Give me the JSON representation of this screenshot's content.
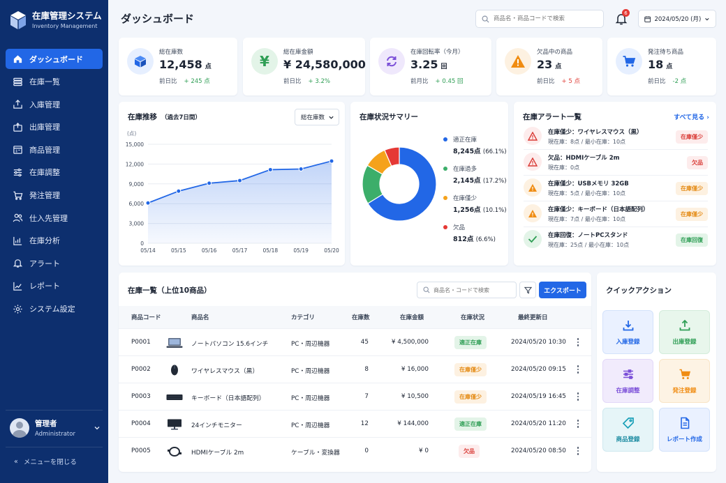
{
  "app": {
    "title": "在庫管理システム",
    "subtitle": "Inventory Management"
  },
  "sidebar": {
    "items": [
      {
        "label": "ダッシュボード",
        "icon": "home-icon",
        "active": true
      },
      {
        "label": "在庫一覧",
        "icon": "list-icon"
      },
      {
        "label": "入庫管理",
        "icon": "inbound-icon"
      },
      {
        "label": "出庫管理",
        "icon": "outbound-icon"
      },
      {
        "label": "商品管理",
        "icon": "product-icon"
      },
      {
        "label": "在庫調整",
        "icon": "sliders-icon"
      },
      {
        "label": "発注管理",
        "icon": "cart-icon"
      },
      {
        "label": "仕入先管理",
        "icon": "users-icon"
      },
      {
        "label": "在庫分析",
        "icon": "analytics-icon"
      },
      {
        "label": "アラート",
        "icon": "bell-icon"
      },
      {
        "label": "レポート",
        "icon": "report-icon"
      },
      {
        "label": "システム設定",
        "icon": "gear-icon"
      }
    ],
    "user": {
      "name": "管理者",
      "role": "Administrator"
    },
    "collapse_label": "メニューを閉じる"
  },
  "header": {
    "title": "ダッシュボード",
    "search_placeholder": "商品名・商品コードで検索",
    "notification_count": "6",
    "date_label": "2024/05/20 (月)"
  },
  "stats": [
    {
      "label": "総在庫数",
      "value": "12,458",
      "unit": "点",
      "compare_label": "前日比",
      "delta": "+ 245 点",
      "trend": "up",
      "icon": "cube-icon",
      "color": "#2267e6",
      "bg": "#e6efff"
    },
    {
      "label": "総在庫金額",
      "value": "¥ 24,580,000",
      "unit": "",
      "compare_label": "前日比",
      "delta": "+ 3.2%",
      "trend": "up",
      "icon": "yen-icon",
      "color": "#2f9e55",
      "bg": "#e3f4e8"
    },
    {
      "label": "在庫回転率（今月）",
      "value": "3.25",
      "unit": "回",
      "compare_label": "前月比",
      "delta": "+ 0.45 回",
      "trend": "up",
      "icon": "refresh-icon",
      "color": "#7b4fd8",
      "bg": "#efe8fc"
    },
    {
      "label": "欠品中の商品",
      "value": "23",
      "unit": "点",
      "compare_label": "前日比",
      "delta": "+ 5 点",
      "trend": "down",
      "icon": "warning-icon",
      "color": "#f08c12",
      "bg": "#fdf1e1"
    },
    {
      "label": "発注待ち商品",
      "value": "18",
      "unit": "点",
      "compare_label": "前日比",
      "delta": "-2 点",
      "trend": "up",
      "icon": "cart-icon",
      "color": "#2267e6",
      "bg": "#e6efff"
    }
  ],
  "trend_card": {
    "title": "在庫推移",
    "subtitle": "（過去7日間）",
    "select_label": "総在庫数"
  },
  "chart_data": [
    {
      "type": "area",
      "title": "在庫推移",
      "ylabel": "(点)",
      "categories": [
        "05/14",
        "05/15",
        "05/16",
        "05/17",
        "05/18",
        "05/19",
        "05/20"
      ],
      "values": [
        6100,
        7900,
        9100,
        9500,
        11150,
        11250,
        12458
      ],
      "yticks": [
        "0",
        "3,000",
        "6,000",
        "9,000",
        "12,000",
        "15,000"
      ],
      "ylim": [
        0,
        15000
      ],
      "grid": true,
      "color": "#2267e6"
    },
    {
      "type": "pie",
      "title": "在庫状況サマリー",
      "series": [
        {
          "name": "適正在庫",
          "value": 8245,
          "value_label": "8,245点",
          "pct": "(66.1%)",
          "color": "#2267e6"
        },
        {
          "name": "在庫過多",
          "value": 2145,
          "value_label": "2,145点",
          "pct": "(17.2%)",
          "color": "#3cae6a"
        },
        {
          "name": "在庫僅少",
          "value": 1256,
          "value_label": "1,256点",
          "pct": "(10.1%)",
          "color": "#f5a21b"
        },
        {
          "name": "欠品",
          "value": 812,
          "value_label": "812点",
          "pct": "(6.6%)",
          "color": "#e53935"
        }
      ]
    }
  ],
  "alerts": {
    "title": "在庫アラート一覧",
    "link_label": "すべて見る",
    "items": [
      {
        "title": "在庫僅少：ワイヤレスマウス（黒）",
        "sub": "現在庫：8点 / 最小在庫：10点",
        "badge": "在庫僅少",
        "kind": "low"
      },
      {
        "title": "欠品：HDMIケーブル 2m",
        "sub": "現在庫：0点",
        "badge": "欠品",
        "kind": "out"
      },
      {
        "title": "在庫僅少：USBメモリ 32GB",
        "sub": "現在庫：5点 / 最小在庫：10点",
        "badge": "在庫僅少",
        "kind": "warn"
      },
      {
        "title": "在庫僅少：キーボード（日本語配列）",
        "sub": "現在庫：7点 / 最小在庫：10点",
        "badge": "在庫僅少",
        "kind": "warn"
      },
      {
        "title": "在庫回復：ノートPCスタンド",
        "sub": "現在庫：25点 / 最小在庫：10点",
        "badge": "在庫回復",
        "kind": "ok"
      }
    ]
  },
  "inventory_table": {
    "title": "在庫一覧（上位10商品）",
    "search_placeholder": "商品名・コードで検索",
    "export_label": "エクスポート",
    "columns": [
      "商品コード",
      "商品名",
      "カテゴリ",
      "在庫数",
      "在庫金額",
      "在庫状況",
      "最終更新日"
    ],
    "rows": [
      {
        "code": "P0001",
        "name": "ノートパソコン 15.6インチ",
        "category": "PC・周辺機器",
        "qty": "45",
        "amount": "¥ 4,500,000",
        "status": "適正在庫",
        "kind": "ok",
        "updated": "2024/05/20 10:30",
        "thumb": "laptop"
      },
      {
        "code": "P0002",
        "name": "ワイヤレスマウス（黒）",
        "category": "PC・周辺機器",
        "qty": "8",
        "amount": "¥ 16,000",
        "status": "在庫僅少",
        "kind": "warn",
        "updated": "2024/05/20 09:15",
        "thumb": "mouse"
      },
      {
        "code": "P0003",
        "name": "キーボード（日本語配列）",
        "category": "PC・周辺機器",
        "qty": "7",
        "amount": "¥ 10,500",
        "status": "在庫僅少",
        "kind": "warn",
        "updated": "2024/05/19 16:45",
        "thumb": "keyboard"
      },
      {
        "code": "P0004",
        "name": "24インチモニター",
        "category": "PC・周辺機器",
        "qty": "12",
        "amount": "¥ 144,000",
        "status": "適正在庫",
        "kind": "ok",
        "updated": "2024/05/20 11:20",
        "thumb": "monitor"
      },
      {
        "code": "P0005",
        "name": "HDMIケーブル 2m",
        "category": "ケーブル・変換器",
        "qty": "0",
        "amount": "¥ 0",
        "status": "欠品",
        "kind": "out",
        "updated": "2024/05/20 08:50",
        "thumb": "cable"
      }
    ]
  },
  "quick_actions": {
    "title": "クイックアクション",
    "items": [
      {
        "label": "入庫登録",
        "icon": "download-icon",
        "color": "#2267e6",
        "bg": "#eaf1ff"
      },
      {
        "label": "出庫登録",
        "icon": "upload-icon",
        "color": "#2f9e55",
        "bg": "#e8f6ec"
      },
      {
        "label": "在庫調整",
        "icon": "sliders-icon",
        "color": "#7b4fd8",
        "bg": "#f1ebfc"
      },
      {
        "label": "発注登録",
        "icon": "cart-icon",
        "color": "#f08c12",
        "bg": "#fdf3e4"
      },
      {
        "label": "商品登録",
        "icon": "tag-icon",
        "color": "#1aa0b8",
        "bg": "#e6f5f8"
      },
      {
        "label": "レポート作成",
        "icon": "document-icon",
        "color": "#2267e6",
        "bg": "#eaf1ff"
      }
    ]
  }
}
